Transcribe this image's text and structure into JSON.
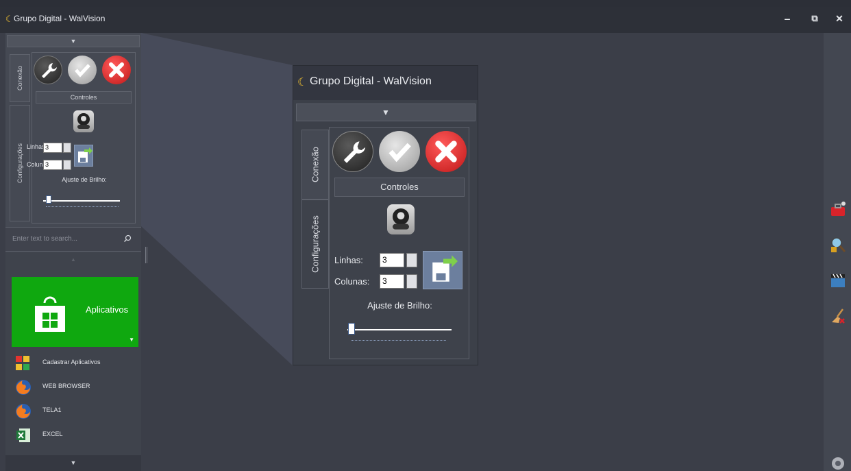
{
  "window": {
    "title": "Grupo Digital - WalVision",
    "logo_glyph": "☾",
    "minimize": "‒",
    "restore": "⧉",
    "close": "✕"
  },
  "panel": {
    "collapse_arrow": "▼",
    "tabs": [
      "Conexão",
      "Configurações"
    ],
    "controls_label": "Controles",
    "rows_label": "Linhas:",
    "rows_value": "3",
    "cols_label": "Colunas:",
    "cols_value": "3",
    "brightness_label": "Ajuste de Brilho:",
    "brightness_level": 0.05
  },
  "search": {
    "placeholder": "Enter text to search...",
    "icon": "search-icon"
  },
  "apps": {
    "scroll_up": "▲",
    "tile_label": "Aplicativos",
    "tile_arrow": "▼",
    "tile_color": "#0fa80f",
    "items": [
      {
        "label": "Cadastrar Aplicativos"
      },
      {
        "label": "WEB BROWSER"
      },
      {
        "label": "TELA1"
      },
      {
        "label": "EXCEL"
      }
    ],
    "scroll_down": "▼"
  },
  "zoom": {
    "title": "Grupo Digital - WalVision"
  },
  "colors": {
    "background": "#3b3e48",
    "accent_yellow": "#f0c030",
    "tile_green": "#0fa80f",
    "close_red": "#d8232a"
  }
}
